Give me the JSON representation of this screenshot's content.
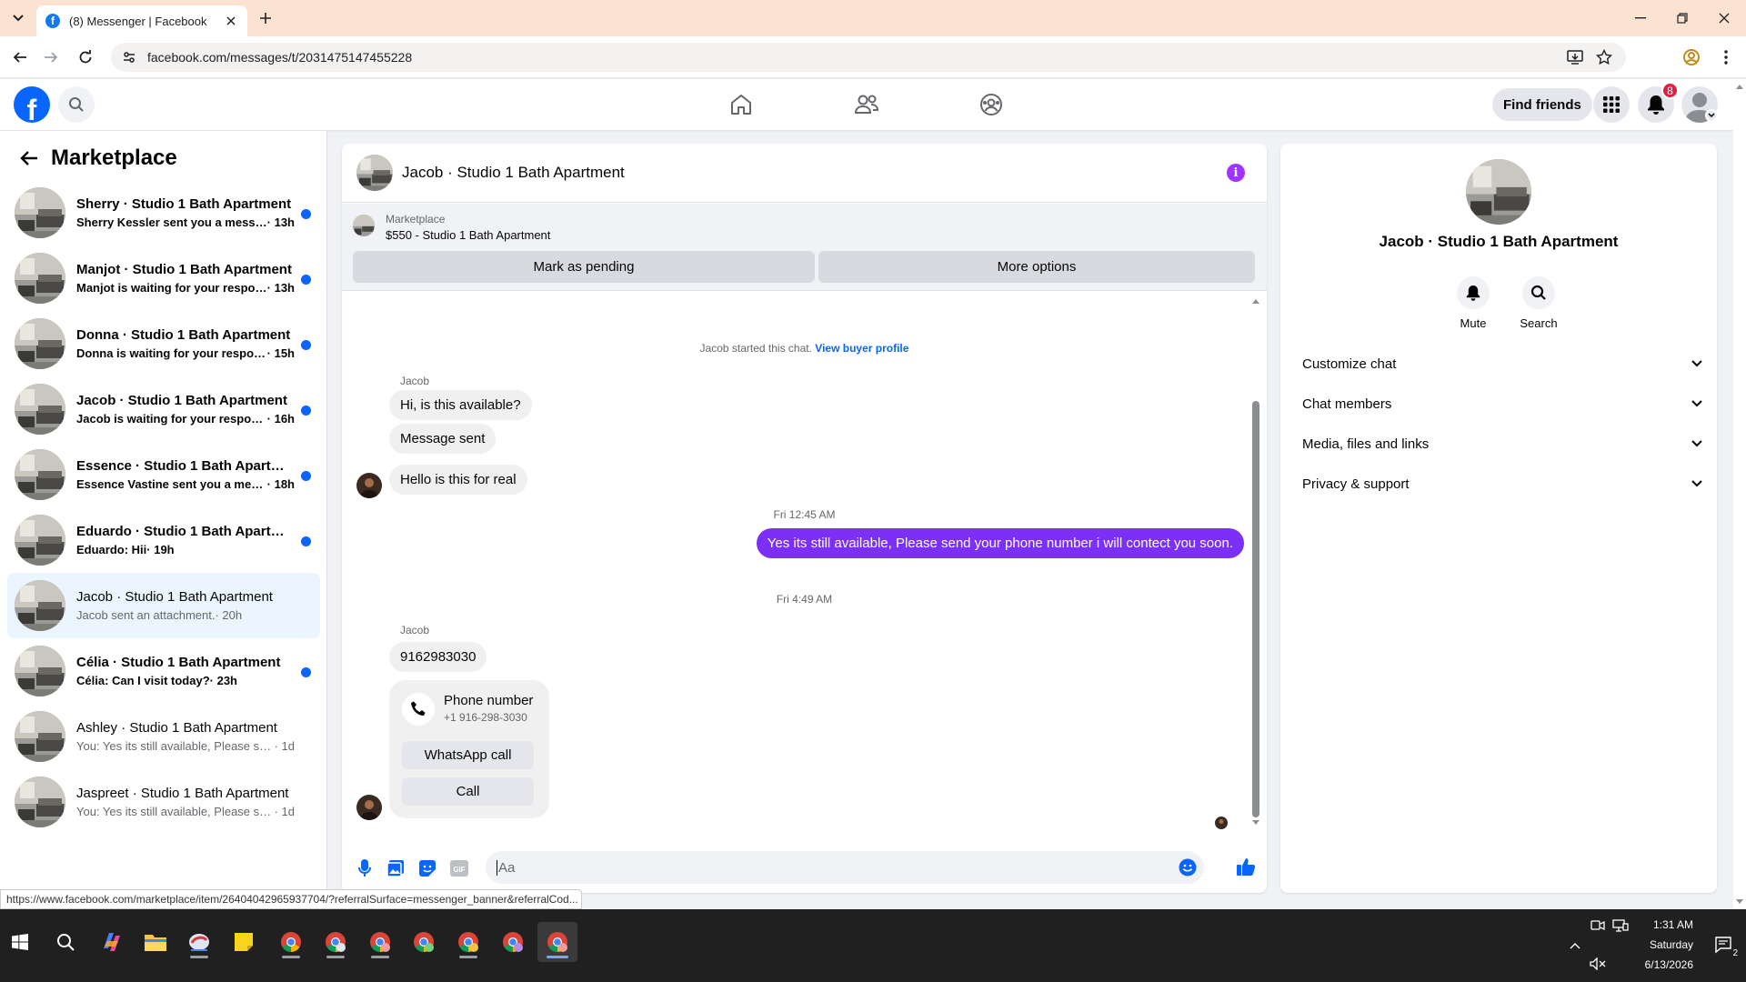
{
  "browser": {
    "tab_title": "(8) Messenger | Facebook",
    "url": "facebook.com/messages/t/2031475147455228",
    "status_url": "https://www.facebook.com/marketplace/item/26404042965937704/?referralSurface=messenger_banner&referralCod..."
  },
  "header": {
    "find_friends": "Find friends",
    "notification_count": "8"
  },
  "sidebar": {
    "title": "Marketplace",
    "conversations": [
      {
        "name": "Sherry · Studio 1 Bath Apartment",
        "preview": "Sherry Kessler sent you a messag...",
        "time": "· 13h",
        "unread": true
      },
      {
        "name": "Manjot · Studio 1 Bath Apartment",
        "preview": "Manjot is waiting for your respon...",
        "time": "· 13h",
        "unread": true
      },
      {
        "name": "Donna · Studio 1 Bath Apartment",
        "preview": "Donna is waiting for your respon...",
        "time": "· 15h",
        "unread": true
      },
      {
        "name": "Jacob · Studio 1 Bath Apartment",
        "preview": "Jacob is waiting for your response.",
        "time": "· 16h",
        "unread": true
      },
      {
        "name": "Essence · Studio 1 Bath Apartment",
        "preview": "Essence Vastine sent you a messa...",
        "time": "· 18h",
        "unread": true
      },
      {
        "name": "Eduardo · Studio 1 Bath Apartment",
        "preview": "Eduardo: Hii",
        "time": "· 19h",
        "unread": true
      },
      {
        "name": "Jacob · Studio 1 Bath Apartment",
        "preview": "Jacob sent an attachment.",
        "time": "· 20h",
        "unread": false,
        "active": true
      },
      {
        "name": "Célia · Studio 1 Bath Apartment",
        "preview": "Célia: Can I visit today?",
        "time": "· 23h",
        "unread": true
      },
      {
        "name": "Ashley · Studio 1 Bath Apartment",
        "preview": "You: Yes its still available, Please send ...",
        "time": "· 1d",
        "unread": false
      },
      {
        "name": "Jaspreet · Studio 1 Bath Apartment",
        "preview": "You: Yes its still available, Please send ...",
        "time": "· 1d",
        "unread": false
      }
    ]
  },
  "chat": {
    "title": "Jacob · Studio 1 Bath Apartment",
    "banner": {
      "label": "Marketplace",
      "item": "$550 - Studio 1 Bath Apartment",
      "mark_pending": "Mark as pending",
      "more_options": "More options"
    },
    "started_text": "Jacob started this chat.",
    "view_profile": "View buyer profile",
    "sender_name": "Jacob",
    "messages": {
      "m1": "Hi, is this available?",
      "m2": "Message sent",
      "m3": "Hello is this for real",
      "time1": "Fri 12:45 AM",
      "out1": "Yes its still available, Please send your phone number i will contect you soon.",
      "time2": "Fri 4:49 AM",
      "m4": "9162983030"
    },
    "phone_card": {
      "title": "Phone number",
      "number": "+1 916-298-3030",
      "whatsapp": "WhatsApp call",
      "call": "Call"
    },
    "composer_placeholder": "Aa"
  },
  "info_panel": {
    "name": "Jacob · Studio 1 Bath Apartment",
    "mute": "Mute",
    "search": "Search",
    "rows": [
      "Customize chat",
      "Chat members",
      "Media, files and links",
      "Privacy & support"
    ]
  },
  "taskbar": {
    "time": "1:31 AM",
    "day": "Saturday",
    "date": "6/13/2026",
    "notif_count": "2"
  },
  "colors": {
    "fb_blue": "#0866ff",
    "outgoing_bubble": "#7b2ff7",
    "unread_dot": "#0866ff",
    "badge_red": "#e41e3f"
  }
}
